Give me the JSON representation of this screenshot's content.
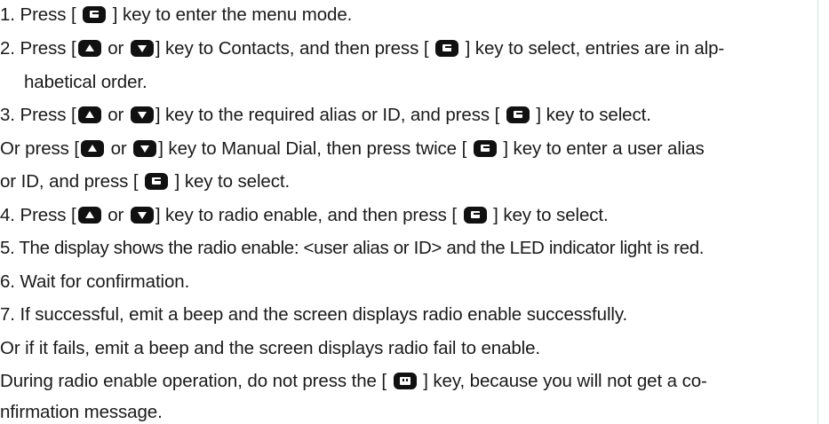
{
  "icons": {
    "enter_key": "enter-key-icon",
    "up_key": "up-arrow-key-icon",
    "down_key": "down-arrow-key-icon",
    "menu_key": "menu-key-icon"
  },
  "lines": [
    {
      "a": "1. Press [ ",
      "b": " ] key to enter the menu mode."
    },
    {
      "a": "2. Press [",
      "or": " or ",
      "b": "] key to Contacts, and then press [ ",
      "c": " ] key to select, entries are in alp-"
    },
    {
      "a": "habetical order."
    },
    {
      "a": "3. Press [",
      "or": " or ",
      "b": "] key to the required alias or ID, and press [ ",
      "c": " ] key to select."
    },
    {
      "a": "Or press [",
      "or": " or ",
      "b": "] key to Manual Dial, then press twice [ ",
      "c": " ] key to enter a user alias"
    },
    {
      "a": "or ID, and press [ ",
      "b": " ] key to select."
    },
    {
      "a": "4. Press [",
      "or": " or ",
      "b": "] key to radio enable, and then press [ ",
      "c": " ] key to select."
    },
    {
      "a": "5. The display shows the radio enable: <user alias or ID> and the LED indicator light is red."
    },
    {
      "a": "6. Wait for confirmation."
    },
    {
      "a": "7. If successful, emit a beep and the screen displays radio enable successfully."
    },
    {
      "a": "Or if it fails, emit a beep and the screen displays radio fail to enable."
    },
    {
      "a": "During radio enable operation, do not press the [ ",
      "b": " ] key, because you will not get a co-"
    },
    {
      "a": "nfirmation message."
    }
  ]
}
